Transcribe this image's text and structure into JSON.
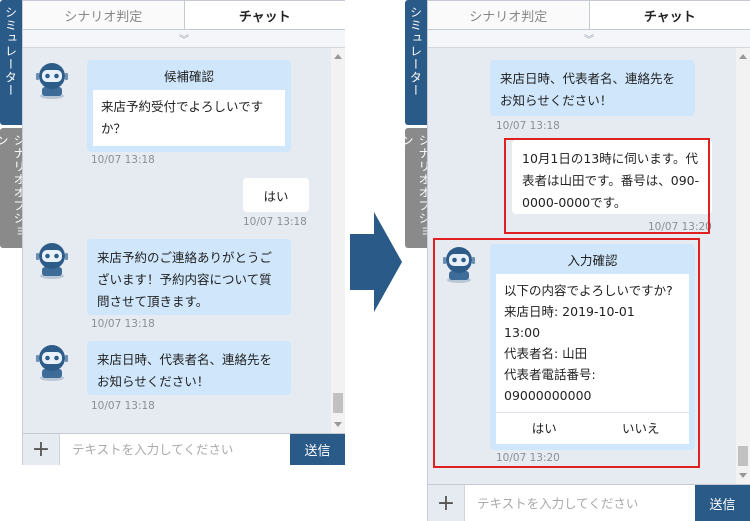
{
  "sidetabs": {
    "simulator": "シミュレーター",
    "scenario_option": "シナリオオプション"
  },
  "tabs": {
    "scenario": "シナリオ判定",
    "chat": "チャット"
  },
  "input": {
    "placeholder": "テキストを入力してください",
    "send": "送信",
    "plus": "+"
  },
  "left": {
    "card": {
      "title": "候補確認",
      "body": "来店予約受付でよろしいですか？",
      "time": "10/07 13:18"
    },
    "user": {
      "text": "はい",
      "time": "10/07 13:18"
    },
    "bot1": {
      "text": "来店予約のご連絡ありがとうございます！予約内容について質問させて頂きます。",
      "time": "10/07 13:18"
    },
    "bot2": {
      "text": "来店日時、代表者名、連絡先をお知らせください！",
      "time": "10/07 13:18"
    }
  },
  "right": {
    "bot1": {
      "text": "来店日時、代表者名、連絡先をお知らせください！",
      "time": "10/07 13:18"
    },
    "user": {
      "text": "10月1日の13時に伺います。代表者は山田です。番号は、090-0000-0000です。",
      "time": "10/07 13:20"
    },
    "confirm": {
      "title": "入力確認",
      "lines": [
        "以下の内容でよろしいですか?",
        "来店日時: 2019-10-01",
        "13:00",
        "代表者名: 山田",
        "代表者電話番号:",
        "09000000000"
      ],
      "yes": "はい",
      "no": "いいえ",
      "time": "10/07 13:20"
    }
  },
  "colors": {
    "accent": "#2a5a87",
    "bot_bubble": "#cfe6fb",
    "highlight": "#e02020",
    "panel_bg": "#e6ebf2"
  },
  "icons": {
    "avatar": "robot-avatar-icon",
    "collapse": "chevron-double-down-icon",
    "arrow": "arrow-right-icon"
  }
}
